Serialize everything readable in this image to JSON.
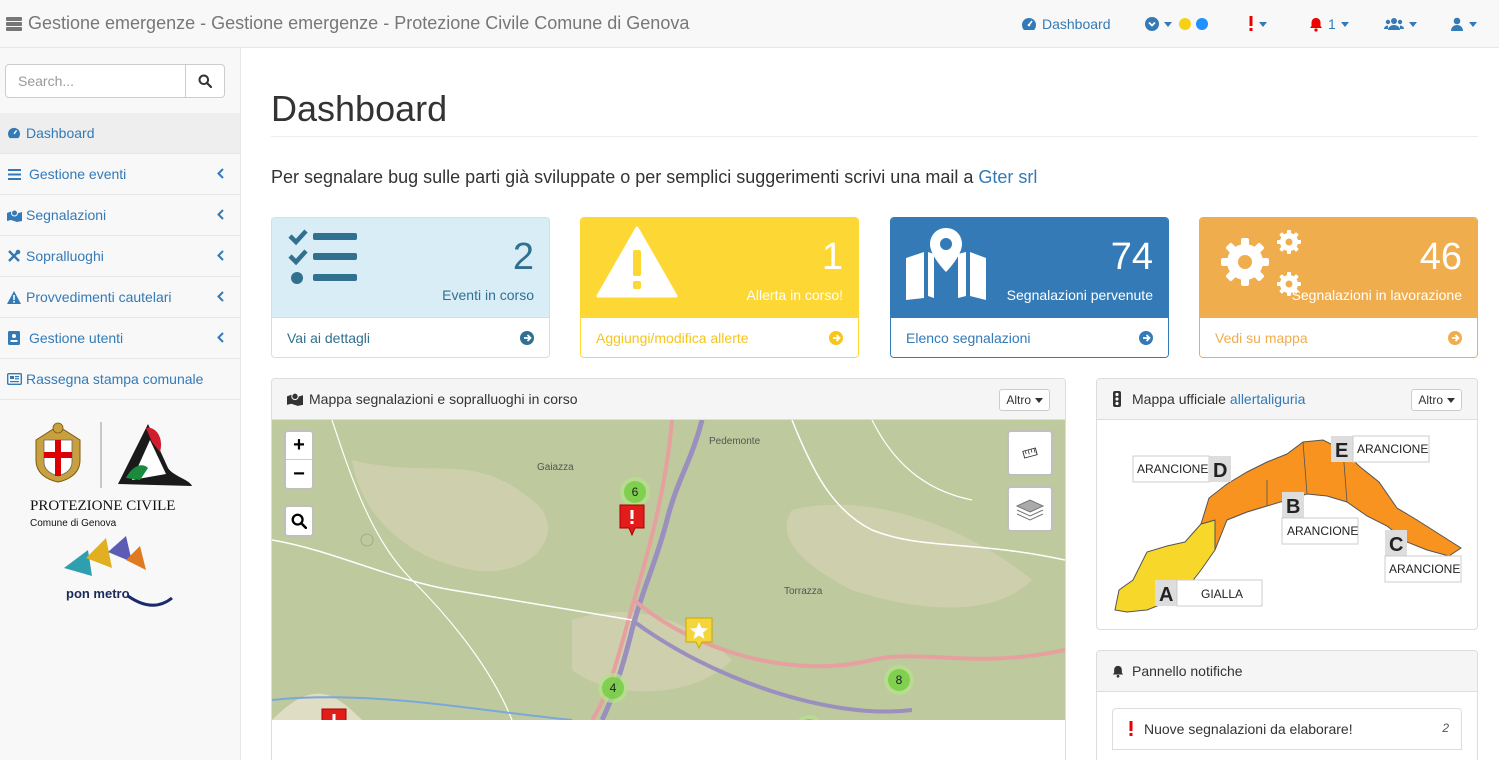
{
  "app": {
    "title": "Gestione emergenze - Gestione emergenze - Protezione Civile Comune di Genova"
  },
  "topnav": {
    "dashboard_label": "Dashboard",
    "alert_count": "1",
    "status_colors": [
      "#f7d117",
      "#1e90ff"
    ]
  },
  "sidebar": {
    "search_placeholder": "Search...",
    "items": [
      {
        "label": "Dashboard",
        "icon": "dashboard-icon"
      },
      {
        "label": "Gestione eventi",
        "icon": "list-icon"
      },
      {
        "label": "Segnalazioni",
        "icon": "map-marker-icon"
      },
      {
        "label": "Sopralluoghi",
        "icon": "tools-icon"
      },
      {
        "label": "Provvedimenti cautelari",
        "icon": "warning-icon"
      },
      {
        "label": "Gestione utenti",
        "icon": "id-card-icon"
      },
      {
        "label": "Rassegna stampa comunale",
        "icon": "newspaper-icon"
      }
    ],
    "logo": {
      "title": "PROTEZIONE CIVILE",
      "subtitle": "Comune di Genova",
      "ponmetro": "pon metro"
    }
  },
  "main": {
    "title": "Dashboard",
    "intro_text": "Per segnalare bug sulle parti già sviluppate o per semplici suggerimenti scrivi una mail a",
    "intro_link": "Gter srl",
    "cards": [
      {
        "number": "2",
        "subtitle": "Eventi in corso",
        "footer": "Vai ai dettagli",
        "color": "#d9edf7"
      },
      {
        "number": "1",
        "subtitle": "Allerta in corso!",
        "footer": "Aggiungi/modifica allerte",
        "color": "#fdd835"
      },
      {
        "number": "74",
        "subtitle": "Segnalazioni pervenute",
        "footer": "Elenco segnalazioni",
        "color": "#337ab7"
      },
      {
        "number": "46",
        "subtitle": "Segnalazioni in lavorazione",
        "footer": "Vedi su mappa",
        "color": "#f0ad4e"
      }
    ],
    "map_panel": {
      "title": "Mappa segnalazioni e sopralluoghi in corso",
      "altro": "Altro",
      "places": [
        "Pedemonte",
        "Gaiazza",
        "Torrazza"
      ],
      "clusters": [
        "6",
        "4",
        "8",
        "8"
      ]
    },
    "allerta_panel": {
      "title": "Mappa ufficiale",
      "link": "allertaliguria",
      "altro": "Altro",
      "zones": [
        {
          "letter": "A",
          "level": "GIALLA"
        },
        {
          "letter": "B",
          "level": "ARANCIONE"
        },
        {
          "letter": "C",
          "level": "ARANCIONE"
        },
        {
          "letter": "D",
          "level": "ARANCIONE"
        },
        {
          "letter": "E",
          "level": "ARANCIONE"
        }
      ]
    },
    "notifiche_panel": {
      "title": "Pannello notifiche",
      "item_label": "Nuove segnalazioni da elaborare!",
      "item_count": "2"
    }
  }
}
